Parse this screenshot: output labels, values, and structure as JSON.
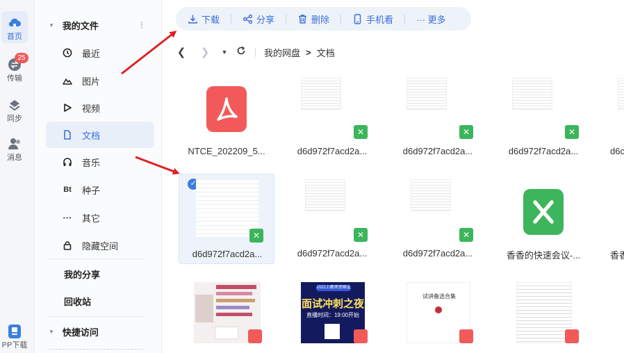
{
  "rail": {
    "items": [
      {
        "label": "首页",
        "icon": "cloud-icon",
        "active": true
      },
      {
        "label": "传输",
        "icon": "transfer-icon",
        "badge": "25"
      },
      {
        "label": "同步",
        "icon": "sync-icon"
      },
      {
        "label": "消息",
        "icon": "contacts-icon"
      },
      {
        "label": "PP下载",
        "icon": "phone-download-icon"
      }
    ]
  },
  "sidebar": {
    "my_files": "我的文件",
    "items": [
      {
        "label": "最近",
        "icon": "clock-icon"
      },
      {
        "label": "图片",
        "icon": "mountain-icon"
      },
      {
        "label": "视频",
        "icon": "play-icon"
      },
      {
        "label": "文档",
        "icon": "document-icon",
        "active": true
      },
      {
        "label": "音乐",
        "icon": "headphones-icon"
      },
      {
        "label": "种子",
        "icon": "bt-icon",
        "icon_text": "Bt"
      },
      {
        "label": "其它",
        "icon": "more-icon",
        "icon_text": "···"
      },
      {
        "label": "隐藏空间",
        "icon": "lock-icon"
      }
    ],
    "my_share": "我的分享",
    "recycle": "回收站",
    "quick_access": "快捷访问"
  },
  "toolbar": {
    "download": "下载",
    "share": "分享",
    "delete": "删除",
    "phone_view": "手机看",
    "more": "··· 更多"
  },
  "breadcrumb": {
    "root": "我的网盘",
    "separator": ">",
    "current": "文档"
  },
  "files": {
    "row1": [
      {
        "name": "NTCE_202209_5...",
        "kind": "pdf-large"
      },
      {
        "name": "d6d972f7acd2a...",
        "kind": "xls-thumb"
      },
      {
        "name": "d6d972f7acd2a...",
        "kind": "xls-thumb"
      },
      {
        "name": "d6d972f7acd2a...",
        "kind": "xls-thumb"
      },
      {
        "name": "d6c",
        "kind": "xls-thumb"
      }
    ],
    "row2": [
      {
        "name": "d6d972f7acd2a...",
        "kind": "xls-thumb",
        "selected": true
      },
      {
        "name": "d6d972f7acd2a...",
        "kind": "xls-thumb"
      },
      {
        "name": "d6d972f7acd2a...",
        "kind": "xls-thumb"
      },
      {
        "name": "香香的快速会议-...",
        "kind": "xls-large"
      },
      {
        "name": "香香",
        "kind": "other"
      }
    ],
    "row3": [
      {
        "kind": "pdf-thumb-notice"
      },
      {
        "kind": "pdf-thumb-poster",
        "poster_title": "面试冲刺之夜",
        "poster_tag": "2022上教师资格证",
        "poster_time": "直播时间：19:00开始"
      },
      {
        "kind": "pdf-thumb-booklet",
        "booklet_title": "试讲备选合集"
      },
      {
        "kind": "pdf-thumb-text"
      }
    ]
  },
  "colors": {
    "accent": "#3a6fd8",
    "excel": "#3cb55c",
    "pdf": "#f25a5a",
    "arrow": "#e02020"
  }
}
